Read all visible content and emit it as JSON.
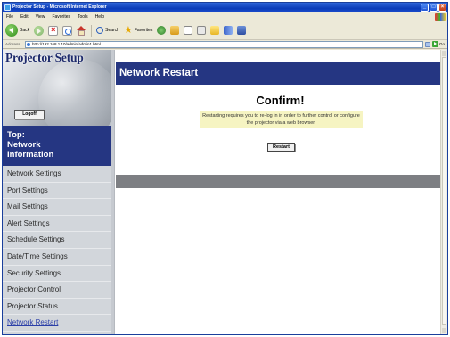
{
  "window": {
    "title": "Projector Setup - Microsoft Internet Explorer",
    "controls": [
      "_",
      "□",
      "×"
    ]
  },
  "menubar": [
    "File",
    "Edit",
    "View",
    "Favorites",
    "Tools",
    "Help"
  ],
  "toolbar": {
    "back": "Back",
    "search": "Search",
    "favorites": "Favorites"
  },
  "address": {
    "label": "Address",
    "url": "http://192.168.1.10/admin/admin1.html",
    "go": "Go"
  },
  "sidebar": {
    "logo": "Projector Setup",
    "logoff": "Logoff",
    "top_nav": [
      "Top:",
      "Network",
      "Information"
    ],
    "items": [
      {
        "label": "Network Settings"
      },
      {
        "label": "Port Settings"
      },
      {
        "label": "Mail Settings"
      },
      {
        "label": "Alert Settings"
      },
      {
        "label": "Schedule Settings"
      },
      {
        "label": "Date/Time Settings"
      },
      {
        "label": "Security Settings"
      },
      {
        "label": "Projector Control"
      },
      {
        "label": "Projector Status"
      },
      {
        "label": "Network Restart"
      }
    ]
  },
  "main": {
    "title": "Network Restart",
    "heading": "Confirm!",
    "message": "Restarting requires you to re-log in in order to further control or configure the projector via a web browser.",
    "button": "Restart"
  },
  "colors": {
    "nav_blue": "#253682",
    "sidebar_bg": "#d2d6db",
    "message_bg": "#f6f4c2",
    "band_grey": "#7d7f83"
  }
}
